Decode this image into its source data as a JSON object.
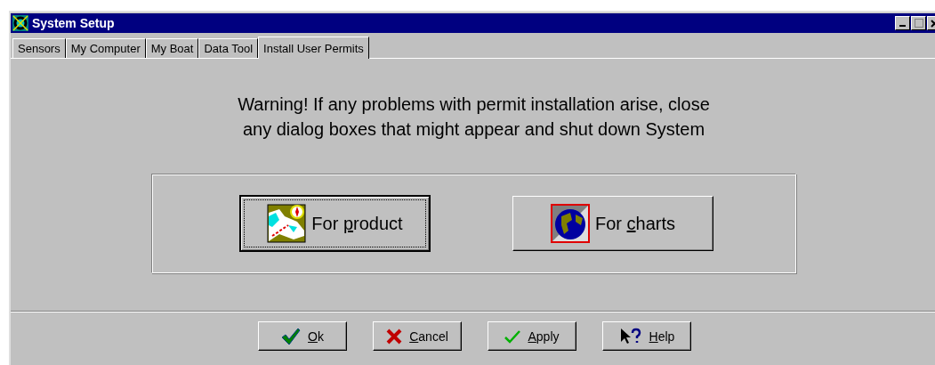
{
  "window": {
    "title": "System Setup"
  },
  "tabs": [
    {
      "label": "Sensors",
      "selected": false
    },
    {
      "label": "My Computer",
      "selected": false
    },
    {
      "label": "My Boat",
      "selected": false
    },
    {
      "label": "Data Tool",
      "selected": false
    },
    {
      "label": "Install User Permits",
      "selected": true
    }
  ],
  "warning": [
    "Warning! If any problems with permit installation arise, close",
    "any dialog boxes that might appear and shut down System"
  ],
  "install_buttons": [
    {
      "label": {
        "before": "For ",
        "key": "p",
        "after": "roduct"
      },
      "kind": "product",
      "default": true
    },
    {
      "label": {
        "before": "For ",
        "key": "c",
        "after": "harts"
      },
      "kind": "charts",
      "default": false
    }
  ],
  "footer_buttons": [
    {
      "label": {
        "key": "O",
        "after": "k"
      },
      "kind": "ok"
    },
    {
      "label": {
        "key": "C",
        "after": "ancel"
      },
      "kind": "cancel"
    },
    {
      "label": {
        "key": "A",
        "after": "pply"
      },
      "kind": "apply"
    },
    {
      "label": {
        "key": "H",
        "after": "elp"
      },
      "kind": "help"
    }
  ]
}
